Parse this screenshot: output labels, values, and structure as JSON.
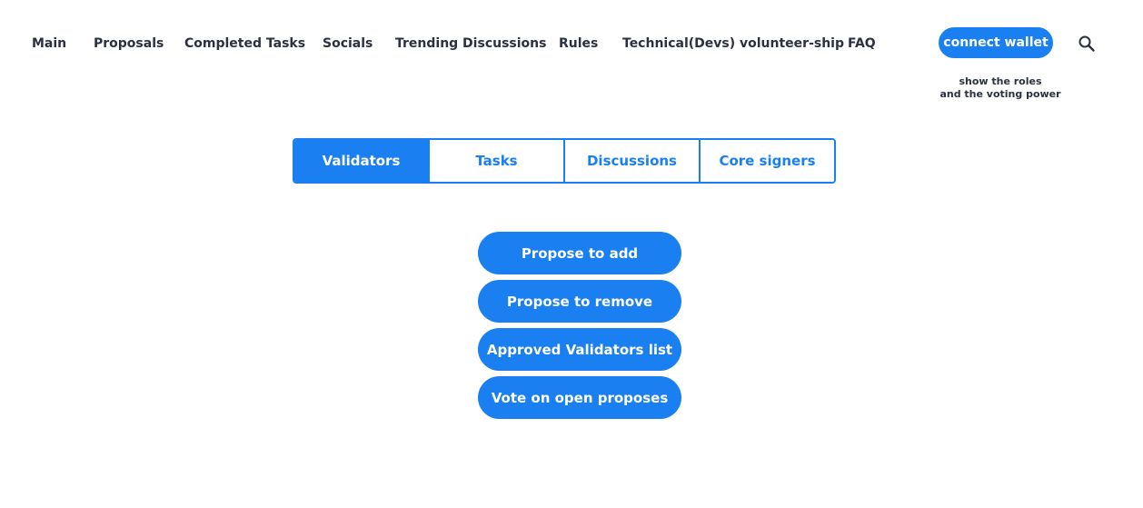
{
  "nav": {
    "items": [
      {
        "label": "Main"
      },
      {
        "label": "Proposals"
      },
      {
        "label": "Completed Tasks"
      },
      {
        "label": "Socials"
      },
      {
        "label": "Trending Discussions"
      },
      {
        "label": "Rules"
      },
      {
        "label": "Technical(Devs) volunteer-ship"
      },
      {
        "label": "FAQ"
      }
    ],
    "connect_wallet_label": "connect wallet",
    "wallet_note_line1": "show the roles",
    "wallet_note_line2": "and the voting power",
    "search_icon": "search-icon"
  },
  "tabs": {
    "items": [
      {
        "label": "Validators",
        "active": true
      },
      {
        "label": "Tasks",
        "active": false
      },
      {
        "label": "Discussions",
        "active": false
      },
      {
        "label": "Core signers",
        "active": false
      }
    ]
  },
  "actions": {
    "items": [
      {
        "label": "Propose to add"
      },
      {
        "label": "Propose to remove"
      },
      {
        "label": "Approved Validators list"
      },
      {
        "label": "Vote on open proposes"
      }
    ]
  },
  "colors": {
    "accent": "#1a7ff0",
    "nav_text": "#2b3140",
    "background": "#ffffff"
  }
}
